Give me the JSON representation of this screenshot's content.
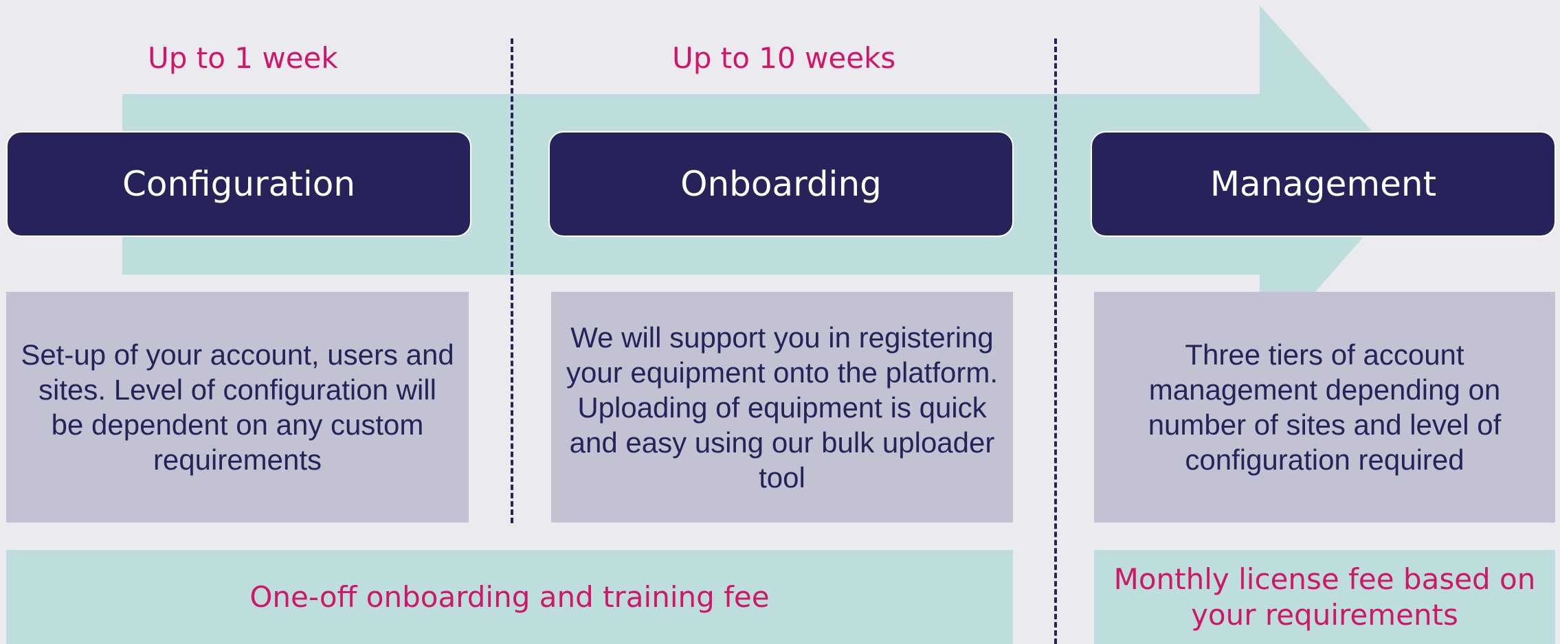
{
  "colors": {
    "background": "#ebeaef",
    "arrow": "#bddedc",
    "phase_box": "#26235a",
    "description_box": "#c3c2d2",
    "fee_box": "#bddedc",
    "accent_text": "#d0166a",
    "body_text": "#26235a"
  },
  "durations": {
    "configuration": "Up to 1 week",
    "onboarding": "Up to 10 weeks"
  },
  "phases": {
    "configuration": {
      "title": "Configuration",
      "description": "Set-up of your account, users and sites. Level of configuration will be dependent on any custom requirements"
    },
    "onboarding": {
      "title": "Onboarding",
      "description": "We will support you in registering your equipment onto the platform. Uploading of equipment is quick and easy using our bulk uploader tool"
    },
    "management": {
      "title": "Management",
      "description": "Three tiers of account management depending on number of sites and level of configuration required"
    }
  },
  "fees": {
    "one_off": "One-off onboarding and training fee",
    "monthly": "Monthly license fee based on your requirements"
  }
}
